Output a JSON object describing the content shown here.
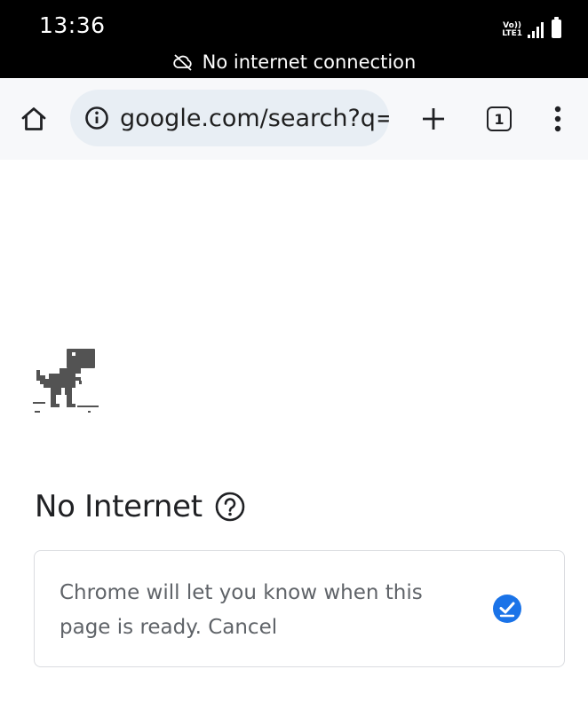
{
  "status_bar": {
    "time": "13:36",
    "network_label_top": "Vo))",
    "network_label_bottom": "LTE1",
    "offline_message": "No internet connection"
  },
  "toolbar": {
    "url": "google.com/search?q=",
    "tab_count": "1"
  },
  "page": {
    "title": "No Internet",
    "notify_text": "Chrome will let you know when this page is ready.",
    "cancel_label": "Cancel"
  },
  "colors": {
    "status_bar_bg": "#000000",
    "toolbar_bg": "#f7f8fa",
    "omnibox_bg": "#e8eef4",
    "accent_blue": "#1a73e8",
    "dino": "#535353"
  },
  "icons": [
    "cloud-off-icon",
    "home-icon",
    "info-icon",
    "plus-icon",
    "tab-switcher-icon",
    "more-vert-icon",
    "dino-icon",
    "help-icon",
    "check-circle-icon"
  ]
}
